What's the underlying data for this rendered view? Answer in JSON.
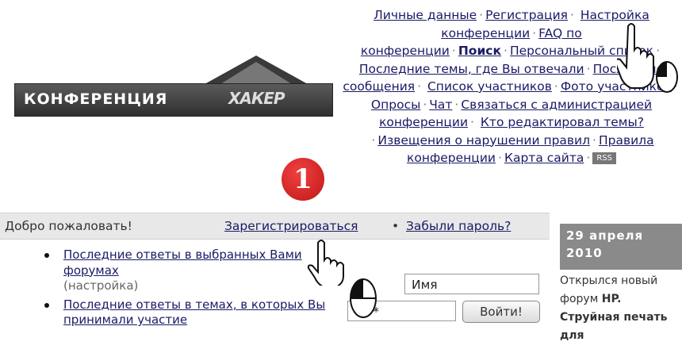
{
  "banner": {
    "title": "КОНФЕРЕНЦИЯ",
    "brand": "ХАКЕР"
  },
  "nav": {
    "personal": "Личные данные",
    "register": "Регистрация",
    "settings": "Настройка конференции",
    "faq": "FAQ по конференции",
    "search": "Поиск",
    "personal_list": "Персональный список",
    "last_topics": "Последние темы, где Вы отвечали",
    "last_messages": "Последние сообщения",
    "members": "Список участников",
    "photos": "Фото участников",
    "polls": "Опросы",
    "chat": "Чат",
    "contact": "Связаться с администрацией конференции",
    "who_edited": "Кто редактировал темы?",
    "violations": "Извещения о нарушении правил",
    "rules": "Правила конференции",
    "sitemap": "Карта сайта",
    "rss": "RSS"
  },
  "badge": "1",
  "welcome": {
    "hello": "Добро пожаловать!",
    "register": "Зарегистрироваться",
    "bullet": "•",
    "forgot": "Забыли пароль?"
  },
  "list": {
    "item1": "Последние ответы в выбранных Вами форумах",
    "item1_note": "(настройка)",
    "item2": "Последние ответы в темах, в которых Вы принимали участие"
  },
  "login": {
    "name_value": "Имя",
    "pass_value": "****",
    "submit": "Войти!"
  },
  "news": {
    "date": "29 апреля 2010",
    "text_start": "Открылся новый форум",
    "text_bold": "HP. Струйная печать для"
  }
}
